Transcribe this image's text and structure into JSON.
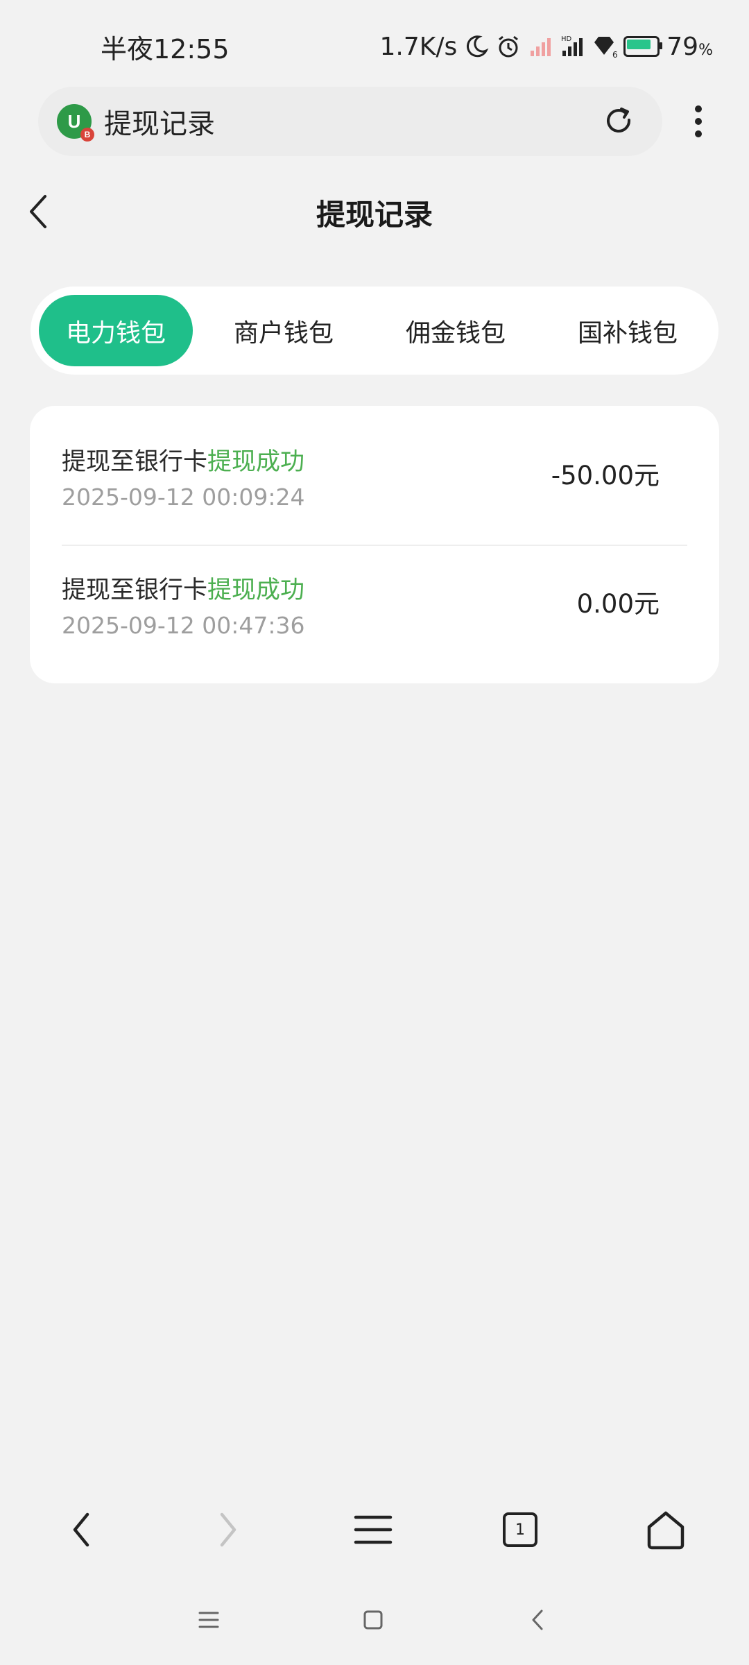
{
  "status_bar": {
    "time": "半夜12:55",
    "network_speed": "1.7K/s",
    "hd_label": "HD",
    "sim_label": "6",
    "battery": "79",
    "battery_unit": "%"
  },
  "address_bar": {
    "site_icon_text": "U",
    "site_badge": "B",
    "title": "提现记录"
  },
  "header": {
    "title": "提现记录"
  },
  "tabs": [
    {
      "label": "电力钱包",
      "active": true
    },
    {
      "label": "商户钱包",
      "active": false
    },
    {
      "label": "佣金钱包",
      "active": false
    },
    {
      "label": "国补钱包",
      "active": false
    }
  ],
  "records": [
    {
      "title": "提现至银行卡",
      "status": "提现成功",
      "time": "2025-09-12 00:09:24",
      "amount": "-50.00元"
    },
    {
      "title": "提现至银行卡",
      "status": "提现成功",
      "time": "2025-09-12 00:47:36",
      "amount": "0.00元"
    }
  ],
  "toolbar": {
    "tab_count": "1"
  },
  "colors": {
    "accent": "#1fbf8a",
    "status_success": "#4caf50",
    "background": "#f2f2f2"
  }
}
